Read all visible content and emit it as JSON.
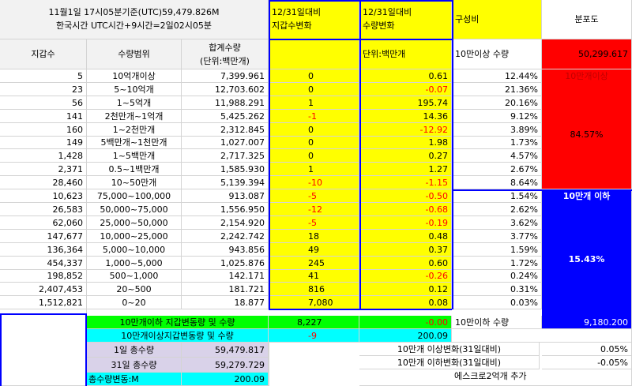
{
  "header": {
    "info_line1": "11월1일 17시05분기준(UTC)59,479.826M",
    "info_line2": "한국시간 UTC시간+9시간=2일02시05분",
    "wallet_change_title_1": "12/31일대비",
    "wallet_change_title_2": "지갑수변화",
    "qty_change_title_1": "12/31일대비",
    "qty_change_title_2": "수량변화",
    "composition_title": "구성비",
    "distribution_title": "분포도"
  },
  "subheader": {
    "wallet_count": "지갑수",
    "qty_range": "수량범위",
    "total_qty_1": "합계수량",
    "total_qty_2": "(단위:백만개)",
    "unit": "단위:백만개",
    "over_100k_label": "10만이상 수량",
    "over_100k_value": "50,299.617"
  },
  "rows": [
    {
      "wallets": "5",
      "range": "10억개이상",
      "total": "7,399.961",
      "wchg": "0",
      "qchg": "0.61",
      "comp": "12.44%"
    },
    {
      "wallets": "23",
      "range": "5~10억개",
      "total": "12,703.602",
      "wchg": "0",
      "qchg": "-0.07",
      "comp": "21.36%"
    },
    {
      "wallets": "56",
      "range": "1~5억개",
      "total": "11,988.291",
      "wchg": "1",
      "qchg": "195.74",
      "comp": "20.16%"
    },
    {
      "wallets": "141",
      "range": "2천만개~1억개",
      "total": "5,425.262",
      "wchg": "-1",
      "qchg": "14.36",
      "comp": "9.12%"
    },
    {
      "wallets": "160",
      "range": "1~2천만개",
      "total": "2,312.845",
      "wchg": "0",
      "qchg": "-12.92",
      "comp": "3.89%"
    },
    {
      "wallets": "149",
      "range": "5백만개~1천만개",
      "total": "1,027.007",
      "wchg": "0",
      "qchg": "1.98",
      "comp": "1.73%"
    },
    {
      "wallets": "1,428",
      "range": "1~5백만개",
      "total": "2,717.325",
      "wchg": "0",
      "qchg": "0.27",
      "comp": "4.57%"
    },
    {
      "wallets": "2,371",
      "range": "0.5~1백만개",
      "total": "1,585.930",
      "wchg": "1",
      "qchg": "1.27",
      "comp": "2.67%"
    },
    {
      "wallets": "28,460",
      "range": "10~50만개",
      "total": "5,139.394",
      "wchg": "-10",
      "qchg": "-1.15",
      "comp": "8.64%"
    },
    {
      "wallets": "10,623",
      "range": "75,000~100,000",
      "total": "913.087",
      "wchg": "-5",
      "qchg": "-0.50",
      "comp": "1.54%"
    },
    {
      "wallets": "26,583",
      "range": "50,000~75,000",
      "total": "1,556.950",
      "wchg": "-12",
      "qchg": "-0.68",
      "comp": "2.62%"
    },
    {
      "wallets": "62,060",
      "range": "25,000~50,000",
      "total": "2,154.920",
      "wchg": "-5",
      "qchg": "-0.19",
      "comp": "3.62%"
    },
    {
      "wallets": "147,677",
      "range": "10,000~25,000",
      "total": "2,242.742",
      "wchg": "18",
      "qchg": "0.48",
      "comp": "3.77%"
    },
    {
      "wallets": "136,364",
      "range": "5,000~10,000",
      "total": "943.856",
      "wchg": "49",
      "qchg": "0.37",
      "comp": "1.59%"
    },
    {
      "wallets": "454,337",
      "range": "1,000~5,000",
      "total": "1,025.876",
      "wchg": "245",
      "qchg": "0.60",
      "comp": "1.72%"
    },
    {
      "wallets": "198,852",
      "range": "500~1,000",
      "total": "142.171",
      "wchg": "41",
      "qchg": "-0.26",
      "comp": "0.24%"
    },
    {
      "wallets": "2,407,453",
      "range": "20~500",
      "total": "181.721",
      "wchg": "816",
      "qchg": "0.12",
      "comp": "0.31%"
    },
    {
      "wallets": "1,512,821",
      "range": "0~20",
      "total": "18.877",
      "wchg": "7,080",
      "qchg": "0.08",
      "comp": "0.03%"
    }
  ],
  "distribution": {
    "over_label": "10만개이상",
    "over_pct": "84.57%",
    "under_label": "10만개 이하",
    "under_pct": "15.43%"
  },
  "summary": {
    "under_change_label": "10만개이하 지갑변동량 및 수량",
    "under_wallet_change": "8,227",
    "under_qty_change": "-0.00",
    "over_change_label": "10만개이상지갑변동량 및 수량",
    "over_wallet_change": "-9",
    "over_qty_change": "200.09",
    "under_100k_label": "10만이하 수량",
    "under_100k_value": "9,180.200",
    "day1_total_label": "1일 총수량",
    "day1_total_value": "59,479.817",
    "day31_total_label": "31일 총수량",
    "day31_total_value": "59,279.729",
    "total_change_label": "총수량변동:M",
    "total_change_value": "200.09",
    "over_change_31_label": "10만개 이상변화(31일대비)",
    "over_change_31_value": "0.05%",
    "under_change_31_label": "10만개 이하변화(31일대비)",
    "under_change_31_value": "-0.05%",
    "escrow_note": "에스크로2억개 추가"
  }
}
